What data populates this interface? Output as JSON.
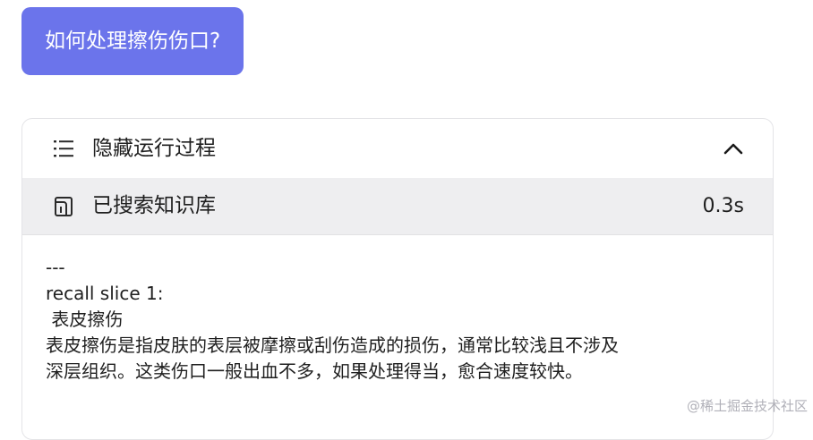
{
  "user_message": {
    "text": "如何处理擦伤伤口?"
  },
  "process_panel": {
    "toggle_label": "隐藏运行过程",
    "steps": [
      {
        "label": "已搜索知识库",
        "duration": "0.3s"
      }
    ],
    "content_lines": [
      "---",
      "recall slice 1:",
      " 表皮擦伤",
      "表皮擦伤是指皮肤的表层被摩擦或刮伤造成的损伤，通常比较浅且不涉及",
      "深层组织。这类伤口一般出血不多，如果处理得当，愈合速度较快。"
    ]
  },
  "icons": {
    "toggle_icon": "list-icon",
    "collapse_icon": "chevron-up-icon",
    "step_icon": "knowledge-base-icon"
  },
  "colors": {
    "user_bubble": "#6b74eb",
    "step_row_bg": "#eeeef0"
  },
  "watermark": "@稀土掘金技术社区"
}
